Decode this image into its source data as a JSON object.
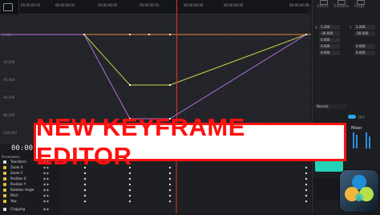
{
  "ruler": {
    "timecodes": [
      "00:00:00:01",
      "00:00:00:01",
      "00:00:00:02",
      "00:00:00:03",
      "00:00:00:04",
      "00:00:00:05",
      "00:00:00:06"
    ]
  },
  "curve_axis": {
    "labels": [
      "0.000",
      "-20.000",
      "-40.000",
      "-60.000",
      "-80.000",
      "-100.000"
    ]
  },
  "timeline": {
    "timecode": "00:00:0"
  },
  "banner": {
    "text": "NEW KEYFRAME EDITOR"
  },
  "inspector": {
    "tabs": [
      "Effects",
      "Transition",
      "Image"
    ],
    "fields": {
      "zoom_x": "1.240",
      "zoom_y": "1.240",
      "pos_x": "-30.000",
      "pos_y": "-50.000",
      "rot": "0.000",
      "anchor_x": "0.000",
      "anchor_y": "0.000",
      "pitch": "0.000",
      "yaw": "0.000"
    },
    "blend_mode": "Normal",
    "mixer_label": "Mixer",
    "off_label": "OFF"
  },
  "params": {
    "title": "Parameters",
    "rows": [
      {
        "name": "Transform",
        "color": "#e0e0e0"
      },
      {
        "name": "Zoom X",
        "color": "#e8c23a"
      },
      {
        "name": "Zoom Y",
        "color": "#e8c23a"
      },
      {
        "name": "Position X",
        "color": "#e8c23a"
      },
      {
        "name": "Position Y",
        "color": "#e8c23a"
      },
      {
        "name": "Rotation Angle",
        "color": "#e8c23a"
      },
      {
        "name": "Pitch",
        "color": "#e8c23a"
      },
      {
        "name": "Yaw",
        "color": "#e8c23a"
      },
      {
        "name": "Cropping",
        "color": "#e0e0e0"
      }
    ]
  },
  "colors": {
    "yellow_curve": "#c9d447",
    "purple_curve": "#b06ee0",
    "orange_curve": "#e58a3a",
    "playhead": "#d6342b",
    "banner_red": "#ff1313"
  }
}
